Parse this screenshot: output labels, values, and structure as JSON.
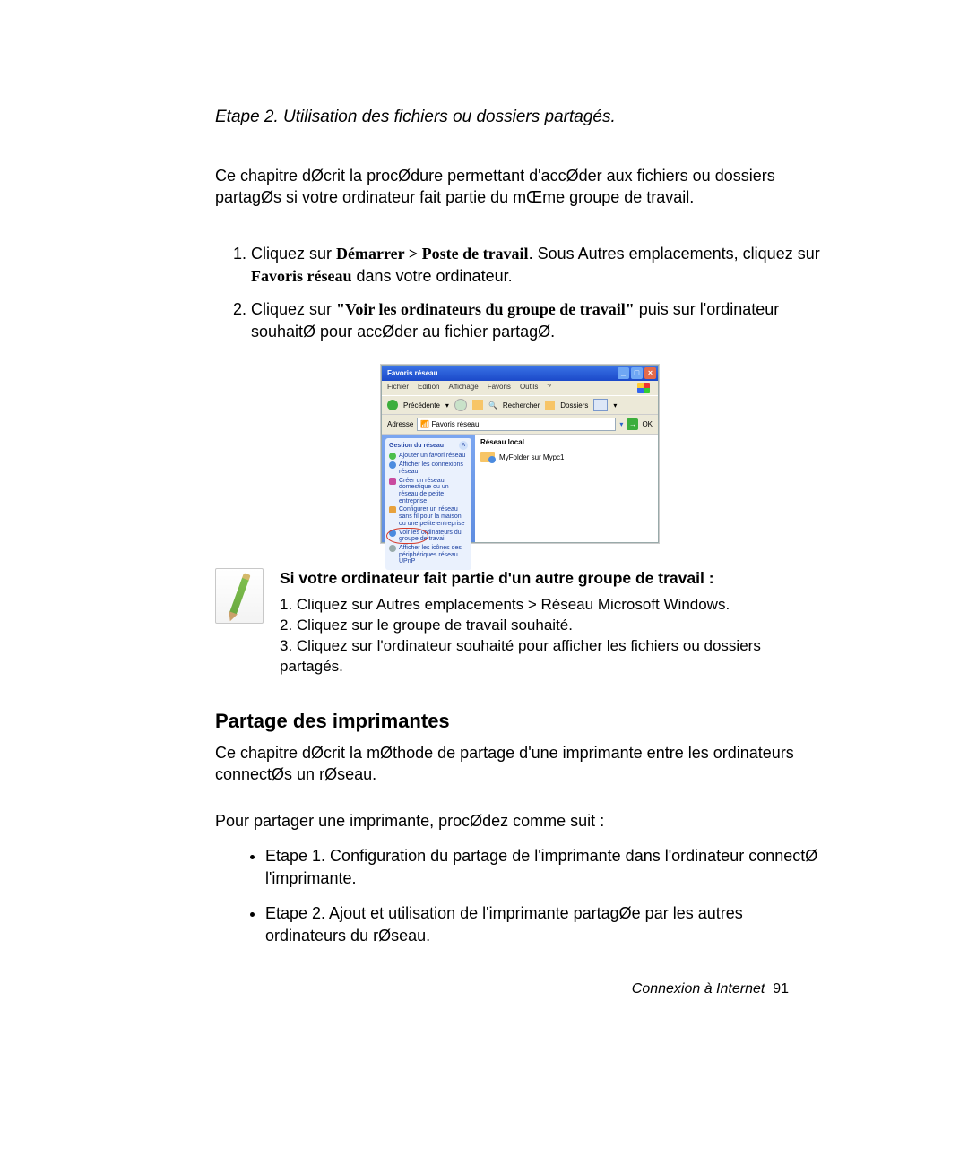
{
  "heading_etape": "Etape 2. Utilisation des fichiers ou dossiers partagés.",
  "intro_para": "Ce chapitre dØcrit la procØdure permettant d'accØder aux fichiers ou dossiers partagØs si votre ordinateur fait partie du mŒme groupe de travail.",
  "steps": {
    "s1_a": "Cliquez sur ",
    "s1_b": "Démarrer > Poste de travail",
    "s1_c": ". Sous Autres emplacements, cliquez sur ",
    "s1_d": "Favoris réseau",
    "s1_e": " dans votre ordinateur.",
    "s2_a": "Cliquez sur ",
    "s2_b": "\"Voir les ordinateurs du groupe de travail\"",
    "s2_c": " puis sur l'ordinateur souhaitØ pour accØder au fichier partagØ."
  },
  "xp": {
    "title": "Favoris réseau",
    "menu": [
      "Fichier",
      "Edition",
      "Affichage",
      "Favoris",
      "Outils",
      "?"
    ],
    "back": "Précédente",
    "search": "Rechercher",
    "folders": "Dossiers",
    "addr_label": "Adresse",
    "addr_value": "Favoris réseau",
    "go": "OK",
    "panel_title": "Gestion du réseau",
    "tasks": [
      "Ajouter un favori réseau",
      "Afficher les connexions réseau",
      "Créer un réseau domestique ou un réseau de petite entreprise",
      "Configurer un réseau sans fil pour la maison ou une petite entreprise",
      "Voir les ordinateurs du groupe de travail",
      "Afficher les icônes des périphériques réseau UPnP"
    ],
    "main_header": "Réseau local",
    "item_label": "MyFolder sur Mypc1"
  },
  "note": {
    "head": "Si votre ordinateur fait partie d'un autre groupe de travail :",
    "l1": "1. Cliquez sur Autres emplacements > Réseau Microsoft Windows.",
    "l2": "2. Cliquez sur le groupe de travail souhaité.",
    "l3": "3. Cliquez sur l'ordinateur souhaité pour afficher les fichiers ou dossiers partagés."
  },
  "section2_h": "Partage des imprimantes",
  "section2_p1": "Ce chapitre dØcrit la mØthode de partage d'une imprimante entre les ordinateurs connectØs  un rØseau.",
  "section2_p2": "Pour partager une imprimante, procØdez comme suit :",
  "bullets": {
    "b1": "Etape 1. Configuration du partage de l'imprimante dans l'ordinateur connectØ  l'imprimante.",
    "b2": "Etape 2. Ajout et utilisation de l'imprimante partagØe par les autres ordinateurs du rØseau."
  },
  "footer_a": "Connexion à Internet",
  "footer_b": "91"
}
